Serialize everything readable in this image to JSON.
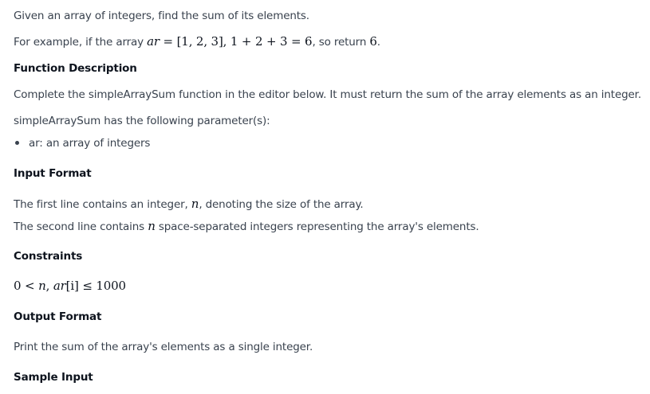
{
  "problem": {
    "intro": "Given an array of integers, find the sum of its elements.",
    "example": {
      "prefix": "For example, if the array ",
      "var_ar": "ar",
      "equals": " = ",
      "array_literal": "[1, 2, 3]",
      "sep": ", ",
      "expression": "1 + 2 + 3 = 6",
      "middle": ", so return ",
      "result": "6",
      "suffix": "."
    },
    "function_description": {
      "heading": "Function Description",
      "text": "Complete the simpleArraySum function in the editor below. It must return the sum of the array elements as an integer.",
      "params_intro": "simpleArraySum has the following parameter(s):",
      "params": [
        "ar: an array of integers"
      ]
    },
    "input_format": {
      "heading": "Input Format",
      "line1_prefix": "The first line contains an integer, ",
      "line1_var": "n",
      "line1_suffix": ", denoting the size of the array.",
      "line2_prefix": "The second line contains ",
      "line2_var": "n",
      "line2_suffix": " space-separated integers representing the array's elements."
    },
    "constraints": {
      "heading": "Constraints",
      "lhs": "0 < ",
      "var_n": "n",
      "comma": ", ",
      "var_ar": "ar",
      "index": "[i]",
      "rhs": " ≤ 1000"
    },
    "output_format": {
      "heading": "Output Format",
      "text": "Print the sum of the array's elements as a single integer."
    },
    "sample_input": {
      "heading": "Sample Input"
    }
  }
}
